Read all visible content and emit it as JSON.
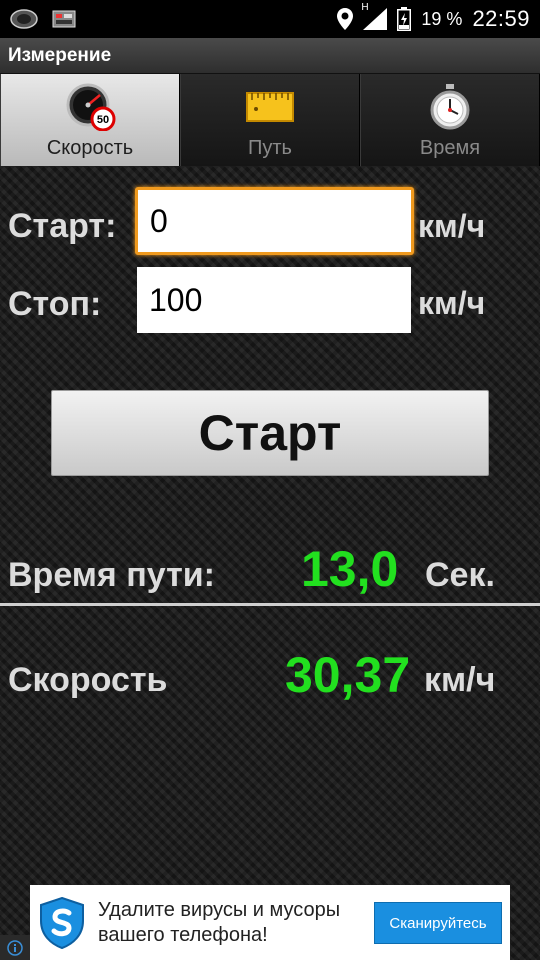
{
  "status_bar": {
    "battery": "19 %",
    "time": "22:59",
    "network": "H",
    "icons": [
      "notification-app-icon",
      "notification-app-icon-2",
      "location-icon",
      "signal-icon",
      "battery-icon"
    ]
  },
  "app": {
    "title": "Измерение"
  },
  "tabs": [
    {
      "label": "Скорость",
      "icon": "speedometer-icon",
      "active": true
    },
    {
      "label": "Путь",
      "icon": "ruler-icon",
      "active": false
    },
    {
      "label": "Время",
      "icon": "stopwatch-icon",
      "active": false
    }
  ],
  "form": {
    "start_label": "Старт:",
    "start_value": "0",
    "stop_label": "Стоп:",
    "stop_value": "100",
    "unit": "км/ч"
  },
  "start_button": {
    "label": "Старт"
  },
  "results": {
    "time_label": "Время пути:",
    "time_value": "13,0",
    "time_unit": "Сек.",
    "speed_label": "Скорость",
    "speed_value": "30,37",
    "speed_unit": "км/ч"
  },
  "ad": {
    "text_line1": "Удалите вирусы и мусоры",
    "text_line2": "вашего телефона!",
    "button": "Сканируйтесь",
    "icon": "shield-icon"
  },
  "colors": {
    "value_green": "#22e01f",
    "focus_orange": "#f09a1e",
    "ad_button": "#1a8fe0"
  }
}
